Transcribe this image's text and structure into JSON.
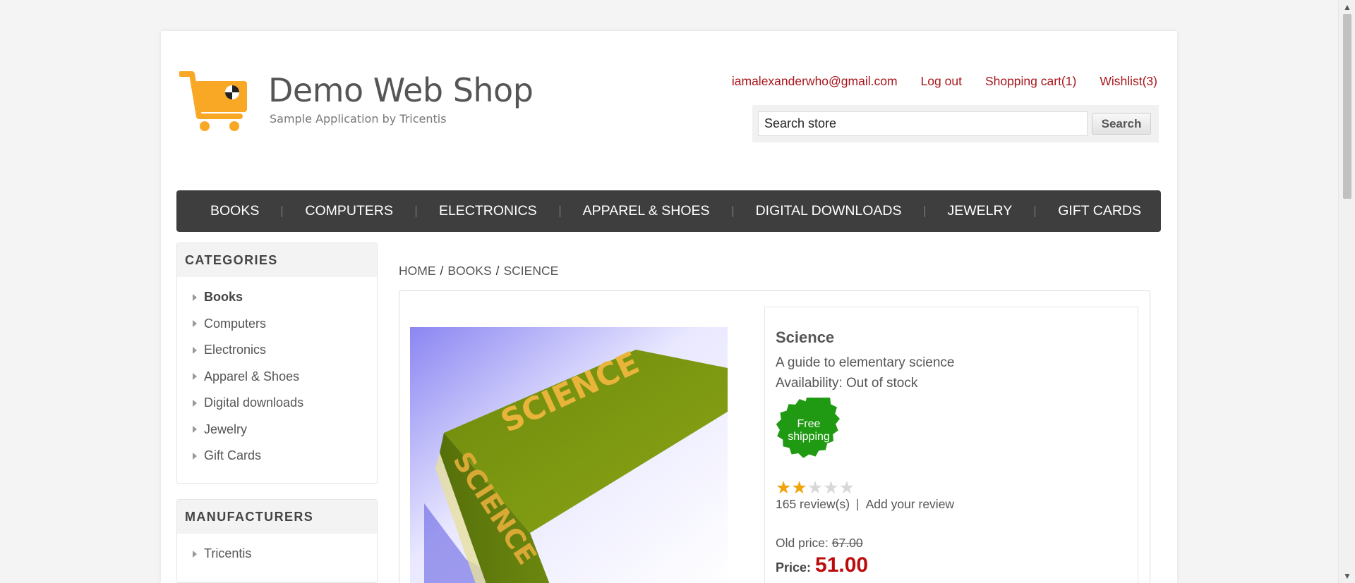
{
  "header": {
    "logo_title": "Demo Web Shop",
    "logo_subtitle": "Sample Application by Tricentis",
    "links": {
      "account": "iamalexanderwho@gmail.com",
      "logout": "Log out",
      "cart": "Shopping cart(1)",
      "wishlist": "Wishlist(3)"
    },
    "search": {
      "value": "Search store",
      "button": "Search"
    }
  },
  "menu": [
    "BOOKS",
    "COMPUTERS",
    "ELECTRONICS",
    "APPAREL & SHOES",
    "DIGITAL DOWNLOADS",
    "JEWELRY",
    "GIFT CARDS"
  ],
  "categories": {
    "title": "CATEGORIES",
    "items": [
      "Books",
      "Computers",
      "Electronics",
      "Apparel & Shoes",
      "Digital downloads",
      "Jewelry",
      "Gift Cards"
    ]
  },
  "manufacturers": {
    "title": "MANUFACTURERS",
    "items": [
      "Tricentis"
    ]
  },
  "breadcrumb": [
    "HOME",
    "BOOKS",
    "SCIENCE"
  ],
  "product": {
    "image_text": "SCIENCE",
    "name": "Science",
    "short_description": "A guide to elementary science",
    "availability": "Availability: Out of stock",
    "free_shipping": [
      "Free",
      "shipping"
    ],
    "rating_stars": 2,
    "rating_max": 5,
    "reviews": "165 review(s)",
    "add_review": "Add your review",
    "old_price_label": "Old price:",
    "old_price": "67.00",
    "price_label": "Price:",
    "price": "51.00"
  },
  "colors": {
    "link": "#a8161c",
    "menu_bg": "#3e3e3e",
    "price": "#bb0c0c",
    "badge": "#1f9a12",
    "logo_orange": "#f9a826"
  }
}
